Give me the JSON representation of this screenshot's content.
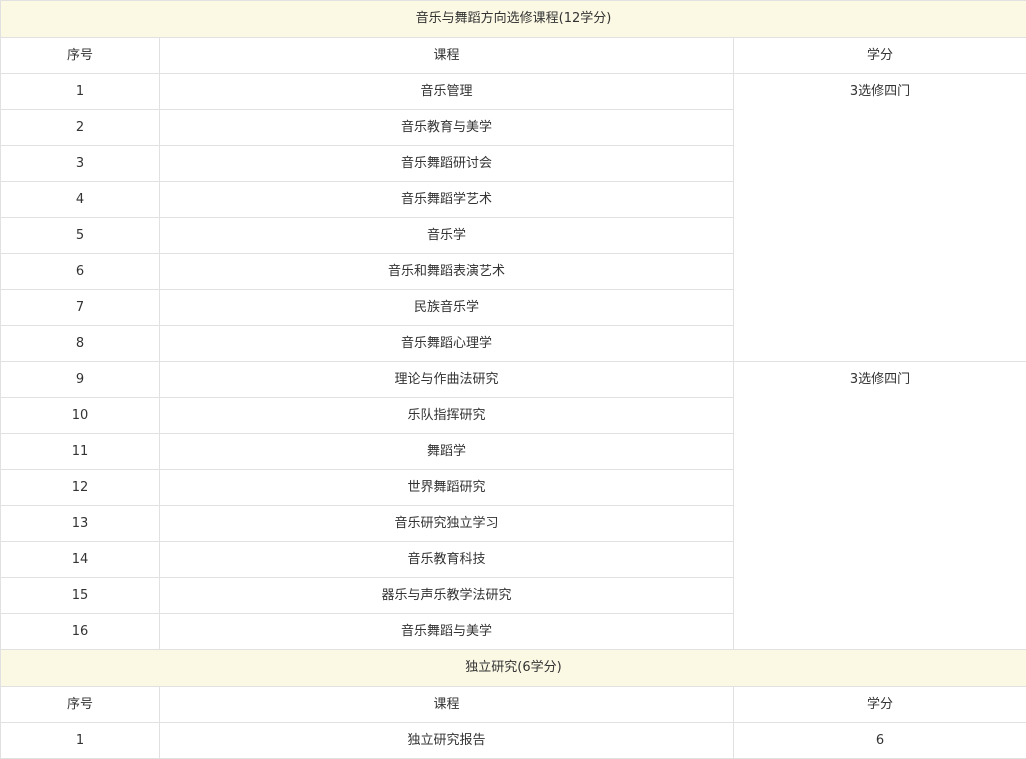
{
  "sections": [
    {
      "title": "音乐与舞蹈方向选修课程(12学分)",
      "headers": {
        "index": "序号",
        "course": "课程",
        "credit": "学分"
      },
      "rows": [
        {
          "index": "1",
          "course": "音乐管理"
        },
        {
          "index": "2",
          "course": "音乐教育与美学"
        },
        {
          "index": "3",
          "course": "音乐舞蹈研讨会"
        },
        {
          "index": "4",
          "course": "音乐舞蹈学艺术"
        },
        {
          "index": "5",
          "course": "音乐学"
        },
        {
          "index": "6",
          "course": "音乐和舞蹈表演艺术"
        },
        {
          "index": "7",
          "course": "民族音乐学"
        },
        {
          "index": "8",
          "course": "音乐舞蹈心理学"
        },
        {
          "index": "9",
          "course": "理论与作曲法研究"
        },
        {
          "index": "10",
          "course": "乐队指挥研究"
        },
        {
          "index": "11",
          "course": "舞蹈学"
        },
        {
          "index": "12",
          "course": "世界舞蹈研究"
        },
        {
          "index": "13",
          "course": "音乐研究独立学习"
        },
        {
          "index": "14",
          "course": "音乐教育科技"
        },
        {
          "index": "15",
          "course": "器乐与声乐教学法研究"
        },
        {
          "index": "16",
          "course": "音乐舞蹈与美学"
        }
      ],
      "credit_groups": [
        {
          "label": "3选修四门"
        },
        {
          "label": "3选修四门"
        }
      ]
    },
    {
      "title": "独立研究(6学分)",
      "headers": {
        "index": "序号",
        "course": "课程",
        "credit": "学分"
      },
      "rows": [
        {
          "index": "1",
          "course": "独立研究报告",
          "credit": "6"
        }
      ]
    }
  ]
}
